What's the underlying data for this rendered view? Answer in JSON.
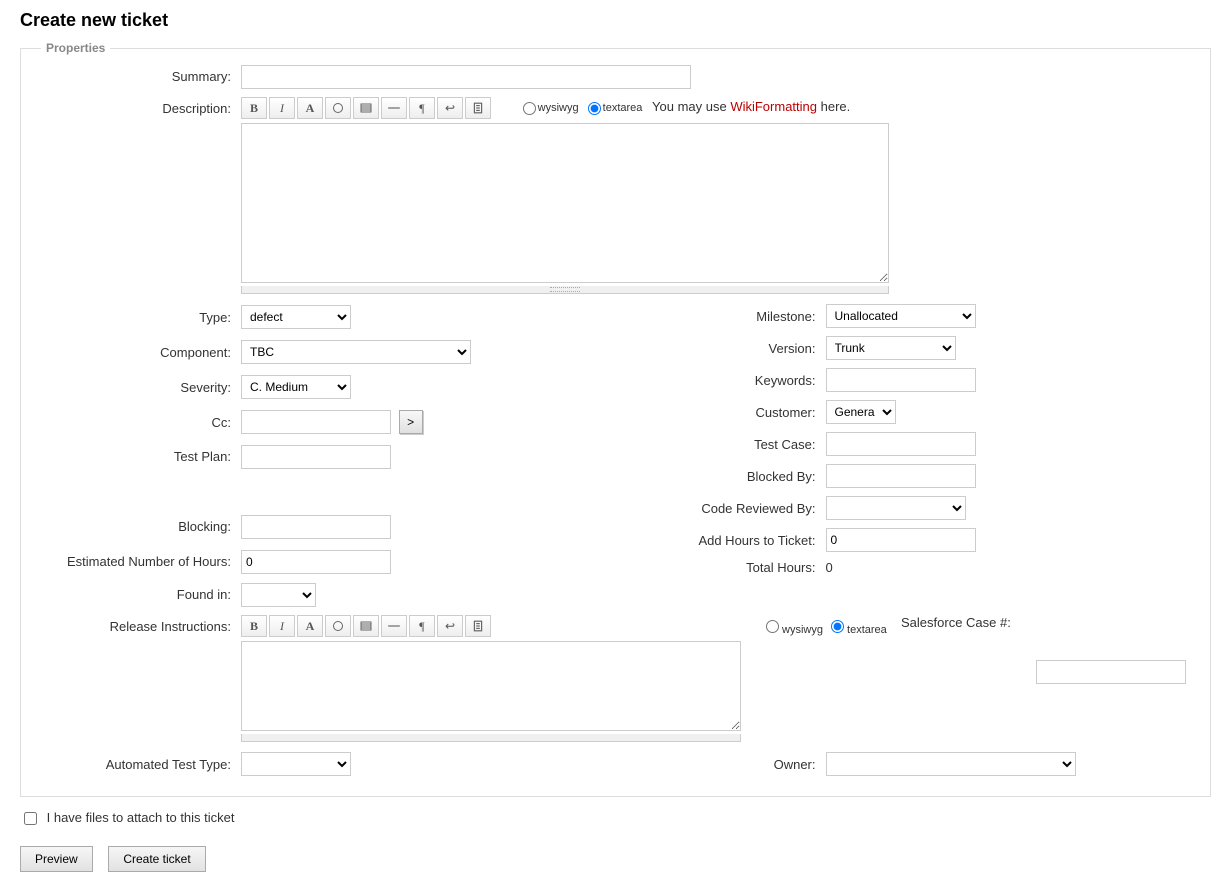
{
  "page": {
    "title": "Create new ticket"
  },
  "fieldset": {
    "legend": "Properties"
  },
  "labels": {
    "summary": "Summary:",
    "description": "Description:",
    "type": "Type:",
    "milestone": "Milestone:",
    "component": "Component:",
    "version": "Version:",
    "severity": "Severity:",
    "keywords": "Keywords:",
    "cc": "Cc:",
    "customer": "Customer:",
    "test_plan": "Test Plan:",
    "test_case": "Test Case:",
    "blocked_by": "Blocked By:",
    "blocking": "Blocking:",
    "code_reviewed_by": "Code Reviewed By:",
    "est_hours": "Estimated Number of Hours:",
    "add_hours": "Add Hours to Ticket:",
    "total_hours": "Total Hours:",
    "found_in": "Found in:",
    "release_instructions": "Release Instructions:",
    "salesforce": "Salesforce Case #:",
    "auto_test_type": "Automated Test Type:",
    "owner": "Owner:"
  },
  "values": {
    "summary": "",
    "description": "",
    "type": "defect",
    "milestone": "Unallocated",
    "component": "TBC",
    "version": "Trunk",
    "severity": "C. Medium",
    "keywords": "",
    "cc": "",
    "customer": "General",
    "test_plan": "",
    "test_case": "",
    "blocked_by": "",
    "blocking": "",
    "code_reviewed_by": "",
    "est_hours": "0",
    "add_hours": "0",
    "total_hours": "0",
    "found_in": "",
    "release_instructions": "",
    "salesforce": "",
    "auto_test_type": "",
    "owner": ""
  },
  "editor": {
    "wysiwyg": "wysiwyg",
    "textarea": "textarea",
    "hint_prefix": "You may use ",
    "hint_link": "WikiFormatting",
    "hint_suffix": " here."
  },
  "cc_button": ">",
  "attach": {
    "label": "I have files to attach to this ticket"
  },
  "buttons": {
    "preview": "Preview",
    "create": "Create ticket"
  },
  "toolbar_icons": [
    "bold",
    "italic",
    "font",
    "link",
    "image",
    "hr",
    "pilcrow",
    "br",
    "code"
  ]
}
